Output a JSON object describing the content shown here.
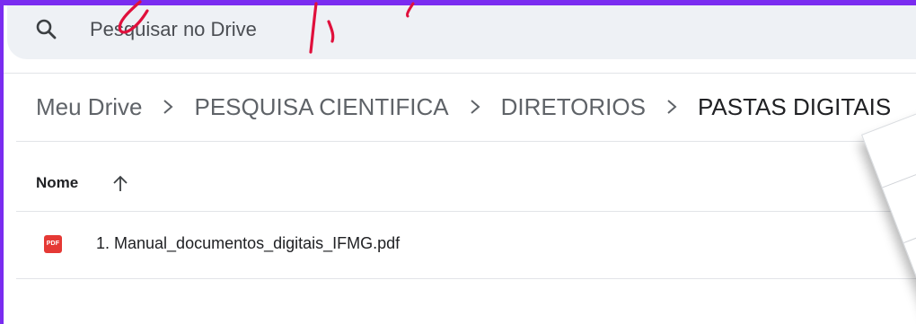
{
  "search": {
    "placeholder": "Pesquisar no Drive"
  },
  "breadcrumb": {
    "items": [
      {
        "label": "Meu Drive"
      },
      {
        "label": "PESQUISA CIENTIFICA"
      },
      {
        "label": "DIRETORIOS"
      },
      {
        "label": "PASTAS DIGITAIS"
      }
    ]
  },
  "table": {
    "columns": [
      {
        "label": "Nome",
        "sort": "ascending"
      }
    ],
    "rows": [
      {
        "name": "1. Manual_documentos_digitais_IFMG.pdf",
        "icon": "pdf-icon",
        "icon_label": "PDF"
      }
    ]
  },
  "colors": {
    "frame": "#7a2cf0",
    "pdf": "#e53935",
    "scribble": "#e0103c"
  },
  "icons": [
    "search-icon",
    "chevron-right-icon",
    "arrow-up-icon",
    "pdf-icon",
    "folder-icon"
  ]
}
